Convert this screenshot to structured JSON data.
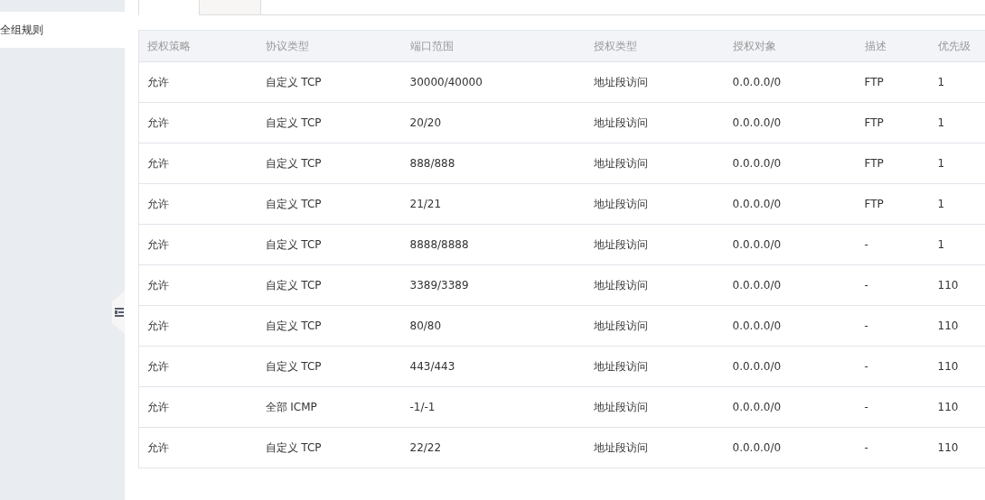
{
  "tabs": [
    {
      "selected": true
    },
    {
      "selected": false
    }
  ],
  "sidebar": {
    "items": [
      {
        "label": "全组规则",
        "selected": true
      }
    ]
  },
  "table": {
    "columns": [
      "授权策略",
      "协议类型",
      "端口范围",
      "授权类型",
      "授权对象",
      "描述",
      "优先级"
    ],
    "rows": [
      [
        "允许",
        "自定义 TCP",
        "30000/40000",
        "地址段访问",
        "0.0.0.0/0",
        "FTP",
        "1"
      ],
      [
        "允许",
        "自定义 TCP",
        "20/20",
        "地址段访问",
        "0.0.0.0/0",
        "FTP",
        "1"
      ],
      [
        "允许",
        "自定义 TCP",
        "888/888",
        "地址段访问",
        "0.0.0.0/0",
        "FTP",
        "1"
      ],
      [
        "允许",
        "自定义 TCP",
        "21/21",
        "地址段访问",
        "0.0.0.0/0",
        "FTP",
        "1"
      ],
      [
        "允许",
        "自定义 TCP",
        "8888/8888",
        "地址段访问",
        "0.0.0.0/0",
        "-",
        "1"
      ],
      [
        "允许",
        "自定义 TCP",
        "3389/3389",
        "地址段访问",
        "0.0.0.0/0",
        "-",
        "110"
      ],
      [
        "允许",
        "自定义 TCP",
        "80/80",
        "地址段访问",
        "0.0.0.0/0",
        "-",
        "110"
      ],
      [
        "允许",
        "自定义 TCP",
        "443/443",
        "地址段访问",
        "0.0.0.0/0",
        "-",
        "110"
      ],
      [
        "允许",
        "全部 ICMP",
        "-1/-1",
        "地址段访问",
        "0.0.0.0/0",
        "-",
        "110"
      ],
      [
        "允许",
        "自定义 TCP",
        "22/22",
        "地址段访问",
        "0.0.0.0/0",
        "-",
        "110"
      ]
    ]
  }
}
